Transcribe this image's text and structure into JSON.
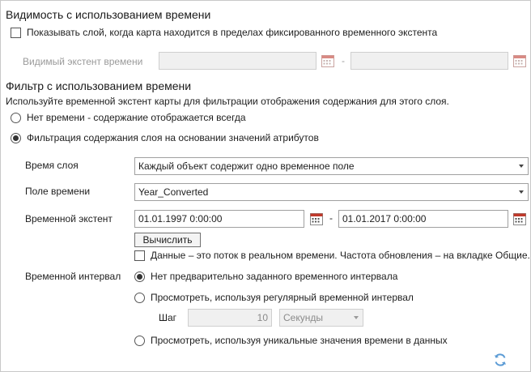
{
  "visibility": {
    "heading": "Видимость с использованием времени",
    "show_layer_label": "Показывать слой, когда карта находится в пределах фиксированного временного экстента",
    "show_layer_checked": false,
    "visible_extent_label": "Видимый экстент времени",
    "start_value": "",
    "end_value": "",
    "separator": "-"
  },
  "filter": {
    "heading": "Фильтр с использованием времени",
    "description": "Используйте временной экстент карты для фильтрации отображения содержания для этого слоя.",
    "option_no_time": "Нет времени - содержание отображается всегда",
    "option_filter_by_attr": "Фильтрация содержания слоя на основании значений атрибутов",
    "selected_option": "option_filter_by_attr",
    "layer_time_label": "Время слоя",
    "layer_time_value": "Каждый объект содержит одно временное поле",
    "time_field_label": "Поле времени",
    "time_field_value": "Year_Converted",
    "time_extent_label": "Временной экстент",
    "extent_start": "01.01.1997 0:00:00",
    "extent_end": "01.01.2017 0:00:00",
    "separator": "-",
    "calculate_button": "Вычислить",
    "live_stream_label": "Данные – это поток в реальном времени. Частота обновления – на вкладке Общие.",
    "live_stream_checked": false,
    "interval_label": "Временной интервал",
    "interval_option_none": "Нет предварительно заданного временного интервала",
    "interval_option_regular": "Просмотреть, используя регулярный временной интервал",
    "step_label": "Шаг",
    "step_value": "10",
    "step_unit": "Секунды",
    "interval_option_unique": "Просмотреть, используя уникальные значения времени в данных",
    "selected_interval": "interval_option_none"
  },
  "icons": {
    "calendar": "calendar-icon",
    "refresh": "refresh-icon"
  },
  "colors": {
    "accent_blue": "#2f7fd8",
    "disabled_text": "#9a9a9a",
    "calendar_red": "#c0392b"
  }
}
